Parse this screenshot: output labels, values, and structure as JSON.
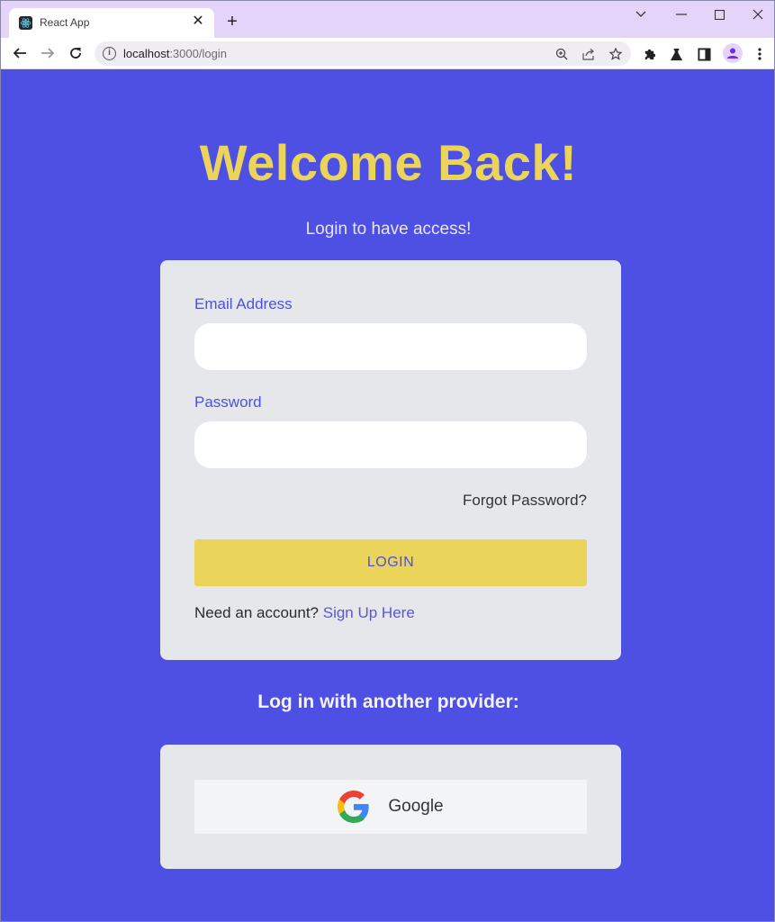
{
  "browser": {
    "tab_title": "React App",
    "tab_close_icon": "close-icon",
    "new_tab_icon": "plus-icon",
    "url_host": "localhost",
    "url_path": ":3000/login",
    "window_controls": {
      "tab_search": "chevron-down-icon",
      "minimize": "minimize-icon",
      "maximize": "maximize-icon",
      "close": "close-icon"
    },
    "nav": {
      "back": "arrow-left-icon",
      "forward": "arrow-right-icon",
      "reload": "reload-icon"
    },
    "omnibox_icons": [
      "zoom-icon",
      "share-icon",
      "star-icon"
    ],
    "extension_icons": [
      "puzzle-icon",
      "flask-icon",
      "side-panel-icon",
      "profile-icon",
      "more-vert-icon"
    ]
  },
  "page": {
    "title": "Welcome Back!",
    "subtitle": "Login to have access!",
    "form": {
      "email_label": "Email Address",
      "email_value": "",
      "email_placeholder": "",
      "password_label": "Password",
      "password_value": "",
      "password_placeholder": "",
      "forgot_password": "Forgot Password?",
      "login_button": "LOGIN",
      "signup_prompt": "Need an account?",
      "signup_link": "Sign Up Here"
    },
    "providers": {
      "title": "Log in with another provider:",
      "google_label": "Google",
      "google_icon": "google-icon"
    }
  },
  "colors": {
    "background": "#4e50e3",
    "accent_yellow": "#ead55a",
    "card": "#e5e7eb",
    "label": "#4e50e3"
  }
}
